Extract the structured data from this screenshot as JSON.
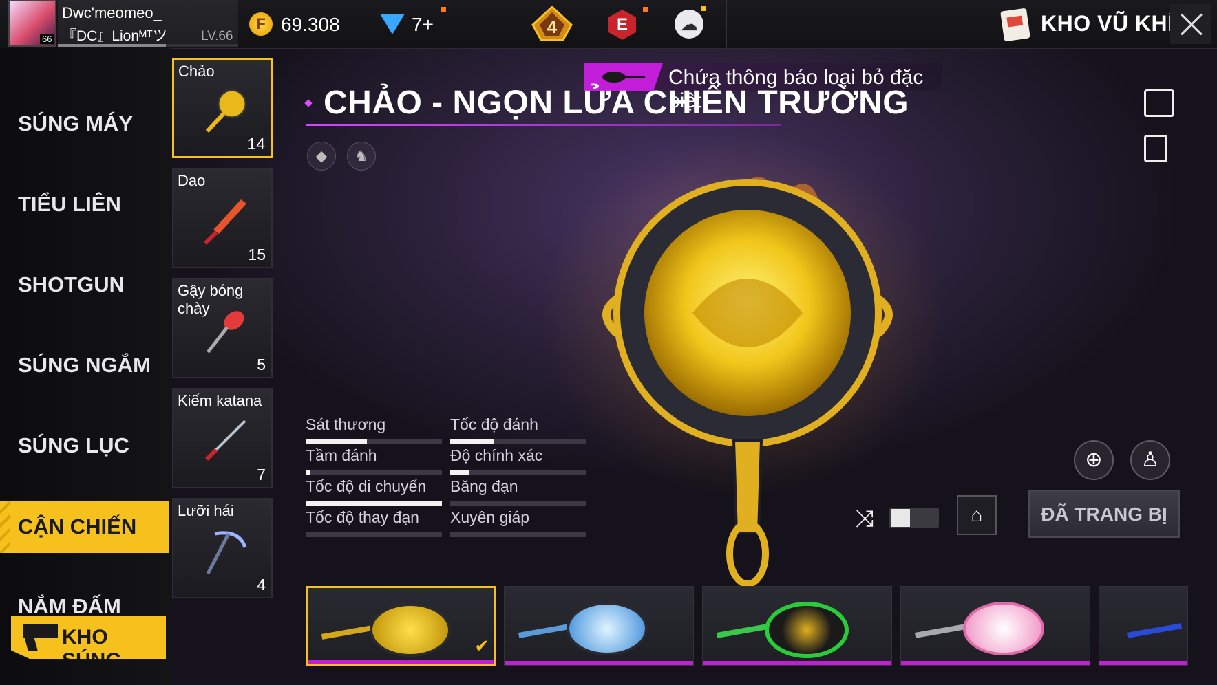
{
  "topbar": {
    "avatar_level": "66",
    "player_name": "Dwc'meomeo_",
    "guild": "『DC』Lionᴹᵀツ",
    "player_level": "LV.66",
    "gold_icon": "F",
    "gold": "69.308",
    "diamonds": "7+",
    "rank_number": "4",
    "event_icon": "E",
    "title": "KHO VŨ KHÍ"
  },
  "sidebar": {
    "categories": [
      "SÚNG MÁY",
      "TIỂU LIÊN",
      "SHOTGUN",
      "SÚNG NGẮM",
      "SÚNG LỤC",
      "CẬN CHIẾN",
      "NẮM ĐẤM"
    ],
    "active": "CẬN CHIẾN",
    "bottom_button": "KHO SÚNG"
  },
  "weapons": [
    {
      "name": "Chảo",
      "count": "14"
    },
    {
      "name": "Dao",
      "count": "15"
    },
    {
      "name": "Gậy bóng chày",
      "count": "5"
    },
    {
      "name": "Kiếm katana",
      "count": "7"
    },
    {
      "name": "Lưỡi hái",
      "count": "4"
    }
  ],
  "detail": {
    "notice": "Chứa thông báo loại bỏ đặc biệt",
    "title": "CHẢO - NGỌN LỬA CHIẾN TRƯỜNG",
    "stats": [
      {
        "name": "Sát thương",
        "value": 0.45
      },
      {
        "name": "Tốc độ đánh",
        "value": 0.32
      },
      {
        "name": "Tầm đánh",
        "value": 0.03
      },
      {
        "name": "Độ chính xác",
        "value": 0.14
      },
      {
        "name": "Tốc độ di chuyển",
        "value": 1.0
      },
      {
        "name": "Băng đạn",
        "value": 0.0
      },
      {
        "name": "Tốc độ thay đạn",
        "value": 0.0
      },
      {
        "name": "Xuyên giáp",
        "value": 0.0
      }
    ],
    "equip_button": "ĐÃ TRANG BỊ"
  },
  "icons": {
    "zoom": "⊕",
    "body": "♙",
    "shuffle": "⤨",
    "home": "⌂"
  },
  "colors": {
    "accent_yellow": "#f6c11c",
    "accent_purple": "#c21dd8"
  }
}
